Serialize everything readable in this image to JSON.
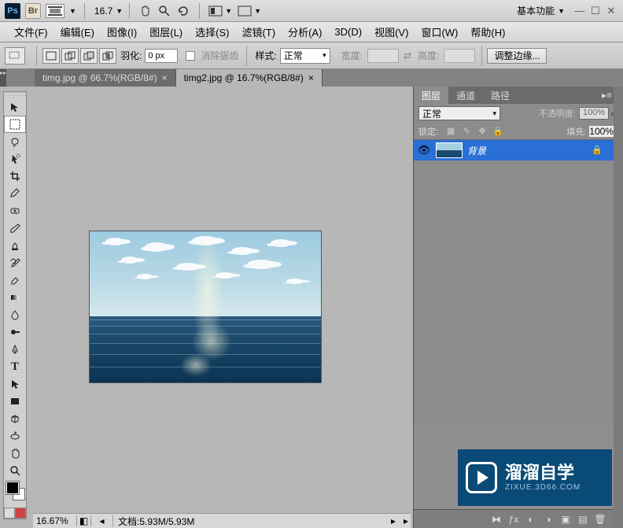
{
  "titlebar": {
    "app_icon_label": "Ps",
    "br_icon_label": "Br",
    "zoom_value": "16.7",
    "workspace": "基本功能"
  },
  "menubar": {
    "items": [
      "文件(F)",
      "编辑(E)",
      "图像(I)",
      "图层(L)",
      "选择(S)",
      "滤镜(T)",
      "分析(A)",
      "3D(D)",
      "视图(V)",
      "窗口(W)",
      "帮助(H)"
    ]
  },
  "optionsbar": {
    "feather_label": "羽化:",
    "feather_value": "0 px",
    "antialias_label": "消除锯齿",
    "style_label": "样式:",
    "style_value": "正常",
    "width_label": "宽度:",
    "height_label": "高度:",
    "adjust_edge_label": "调整边缘..."
  },
  "tabs": [
    {
      "label": "timg.jpg @ 66.7%(RGB/8#)",
      "active": false
    },
    {
      "label": "timg2.jpg @ 16.7%(RGB/8#)",
      "active": true
    }
  ],
  "statusbar": {
    "zoom": "16.67%",
    "doc_label": "文档:",
    "doc_info": "5.93M/5.93M"
  },
  "layers_panel": {
    "tabs": [
      "图层",
      "通道",
      "路径"
    ],
    "blend_mode": "正常",
    "opacity_label": "不透明度:",
    "opacity_value": "100%",
    "lock_label": "锁定:",
    "fill_label": "填充:",
    "fill_value": "100%",
    "layers": [
      {
        "name": "背景",
        "locked": true,
        "visible": true
      }
    ]
  },
  "watermark": {
    "main": "溜溜自学",
    "sub": "ZIXUE.3D66.COM"
  }
}
